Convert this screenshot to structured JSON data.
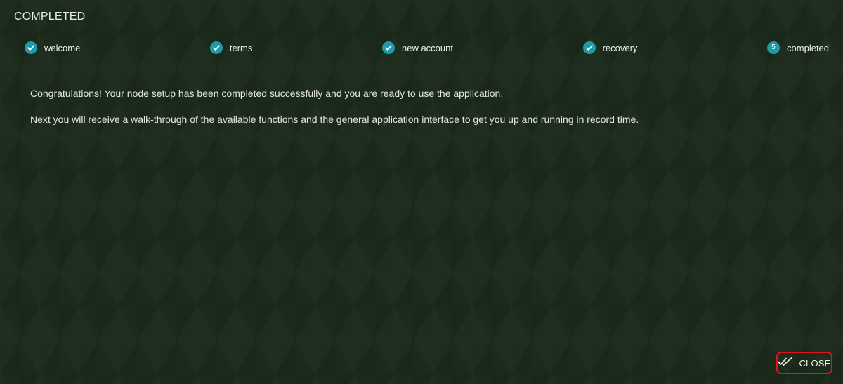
{
  "page_title": "COMPLETED",
  "stepper": {
    "steps": [
      {
        "label": "welcome",
        "state": "done",
        "icon": "check-icon"
      },
      {
        "label": "terms",
        "state": "done",
        "icon": "check-icon"
      },
      {
        "label": "new account",
        "state": "done",
        "icon": "check-icon"
      },
      {
        "label": "recovery",
        "state": "done",
        "icon": "check-icon"
      },
      {
        "label": "completed",
        "state": "active",
        "number": "5"
      }
    ],
    "accent_color": "#1e9aa8"
  },
  "content": {
    "paragraph_1": "Congratulations! Your node setup has been completed successfully and you are ready to use the application.",
    "paragraph_2": "Next you will receive a walk-through of the available functions and the general application interface to get you up and running in record time."
  },
  "footer": {
    "close_label": "CLOSE",
    "close_icon": "double-check-icon",
    "highlight_color": "#e0151b"
  }
}
